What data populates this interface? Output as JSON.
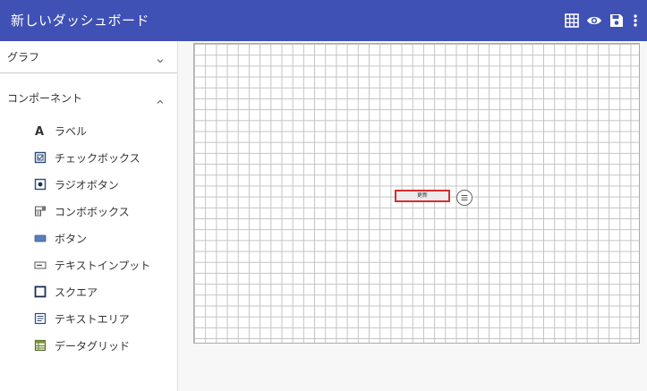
{
  "header": {
    "title": "新しいダッシュボード",
    "bg_color": "#3f51b5",
    "icons": [
      "grid-icon",
      "eye-icon",
      "save-icon",
      "more-vert-icon"
    ]
  },
  "sidebar": {
    "graph_section": {
      "label": "グラフ",
      "expanded": false
    },
    "component_section": {
      "label": "コンポーネント",
      "expanded": true
    },
    "items": [
      {
        "label": "ラベル",
        "icon": "label-icon"
      },
      {
        "label": "チェックボックス",
        "icon": "checkbox-icon"
      },
      {
        "label": "ラジオボタン",
        "icon": "radio-button-icon"
      },
      {
        "label": "コンボボックス",
        "icon": "combobox-icon"
      },
      {
        "label": "ボタン",
        "icon": "button-icon"
      },
      {
        "label": "テキストインプット",
        "icon": "text-input-icon"
      },
      {
        "label": "スクエア",
        "icon": "square-icon"
      },
      {
        "label": "テキストエリア",
        "icon": "textarea-icon"
      },
      {
        "label": "データグリッド",
        "icon": "datagrid-icon"
      }
    ]
  },
  "canvas": {
    "placed_button": {
      "label": "更新",
      "selected_border_color": "#d32f2f"
    }
  }
}
